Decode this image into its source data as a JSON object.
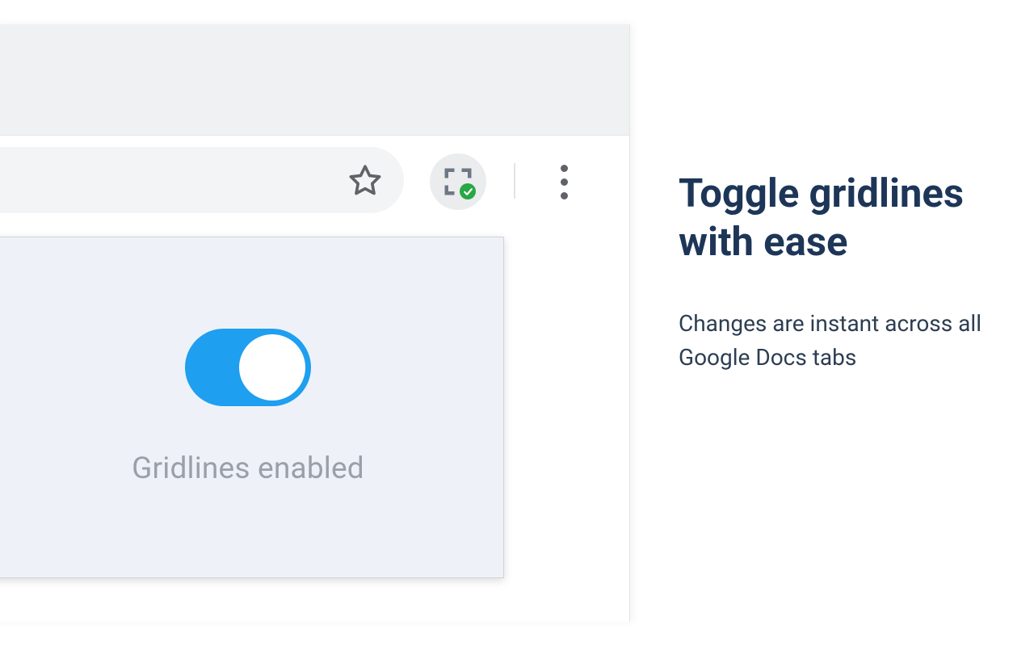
{
  "promo": {
    "title": "Toggle gridlines with ease",
    "subtitle": "Changes are instant across all Google Docs tabs"
  },
  "popup": {
    "label": "Gridlines enabled",
    "toggle_on": true
  },
  "toolbar": {
    "star_label": "Bookmark",
    "extension_label": "Gridlines extension",
    "menu_label": "More"
  },
  "colors": {
    "accent": "#1e9ff0",
    "title": "#1d3658",
    "success_badge": "#28a745"
  }
}
